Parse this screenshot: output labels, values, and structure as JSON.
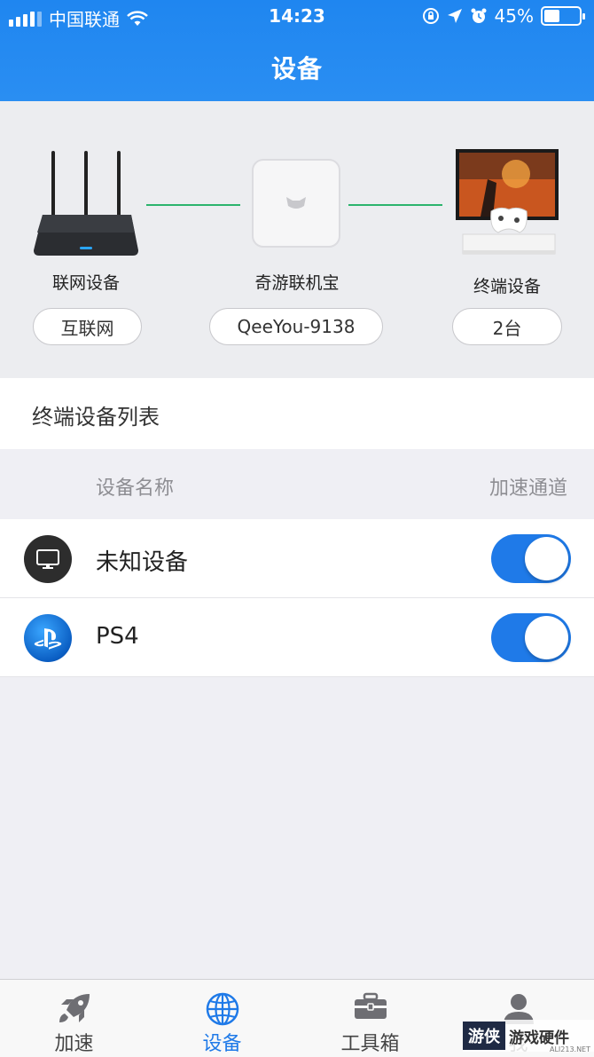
{
  "status_bar": {
    "carrier": "中国联通",
    "time": "14:23",
    "battery": "45%",
    "battery_level": 0.45,
    "icons": [
      "signal-icon",
      "wifi-icon",
      "orientation-lock-icon",
      "location-icon",
      "alarm-icon",
      "battery-icon"
    ]
  },
  "header": {
    "title": "设备"
  },
  "topology": {
    "nodes": [
      {
        "label": "联网设备",
        "value": "互联网",
        "icon": "router-icon"
      },
      {
        "label": "奇游联机宝",
        "value": "QeeYou-9138",
        "icon": "qeeyou-box-icon"
      },
      {
        "label": "终端设备",
        "value": "2台",
        "icon": "tv-console-icon"
      }
    ],
    "link_color": "#2cb46d"
  },
  "device_list": {
    "title": "终端设备列表",
    "col_name": "设备名称",
    "col_channel": "加速通道",
    "rows": [
      {
        "name": "未知设备",
        "icon": "monitor-icon",
        "accelerated": true
      },
      {
        "name": "PS4",
        "icon": "playstation-icon",
        "accelerated": true
      }
    ]
  },
  "tabbar": {
    "tabs": [
      {
        "label": "加速",
        "icon": "rocket-icon",
        "active": false
      },
      {
        "label": "设备",
        "icon": "globe-icon",
        "active": true
      },
      {
        "label": "工具箱",
        "icon": "toolbox-icon",
        "active": false
      },
      {
        "label": "我",
        "icon": "user-icon",
        "active": false
      }
    ]
  },
  "watermark": {
    "brand": "游侠",
    "text": "游戏硬件",
    "sub": "ALI213.NET"
  },
  "colors": {
    "accent": "#1f7ae8",
    "header": "#2a8ef2",
    "link": "#2cb46d"
  }
}
